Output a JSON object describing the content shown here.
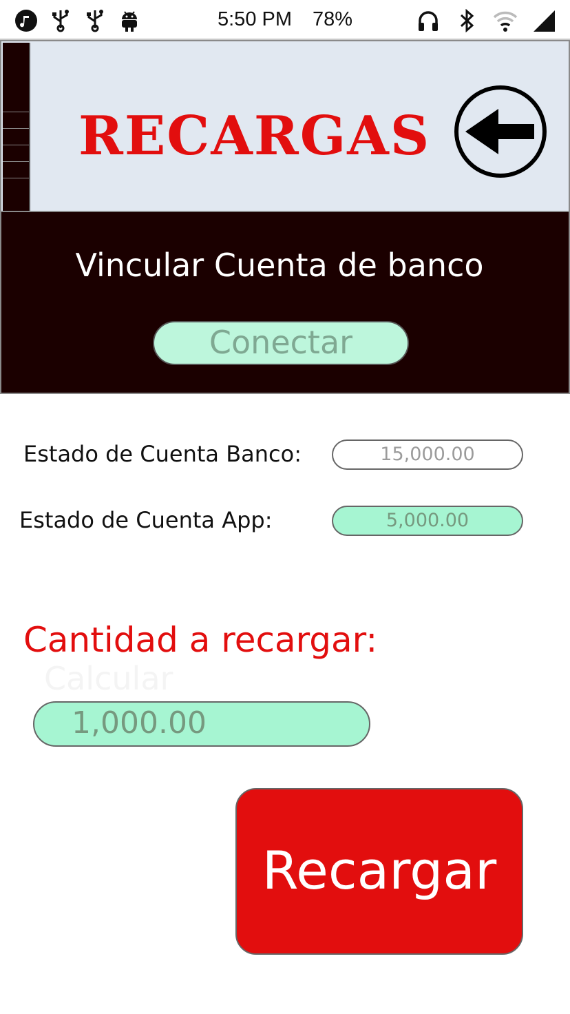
{
  "status_bar": {
    "time": "5:50 PM",
    "battery": "78%",
    "left_icons": [
      "music-note-icon",
      "usb-icon",
      "usb-icon",
      "android-icon"
    ],
    "right_icons": [
      "headphones-icon",
      "bluetooth-icon",
      "wifi-icon",
      "cell-signal-icon"
    ]
  },
  "header": {
    "title": "RECARGAS",
    "back_icon": "arrow-left-icon"
  },
  "bank": {
    "title": "Vincular Cuenta de banco",
    "connect_label": "Conectar"
  },
  "balances": {
    "bank_label": "Estado de Cuenta Banco:",
    "bank_value": "15,000.00",
    "app_label": "Estado de Cuenta App:",
    "app_value": "5,000.00"
  },
  "recharge": {
    "amount_label": "Cantidad a recargar:",
    "ghost_text": "Calcular",
    "amount_value": "1,000.00",
    "button_label": "Recargar"
  },
  "colors": {
    "accent_red": "#e20e0e",
    "mint": "#a6f5d2",
    "dark_panel": "#1b0000",
    "header_bg": "#e1e8f1"
  }
}
